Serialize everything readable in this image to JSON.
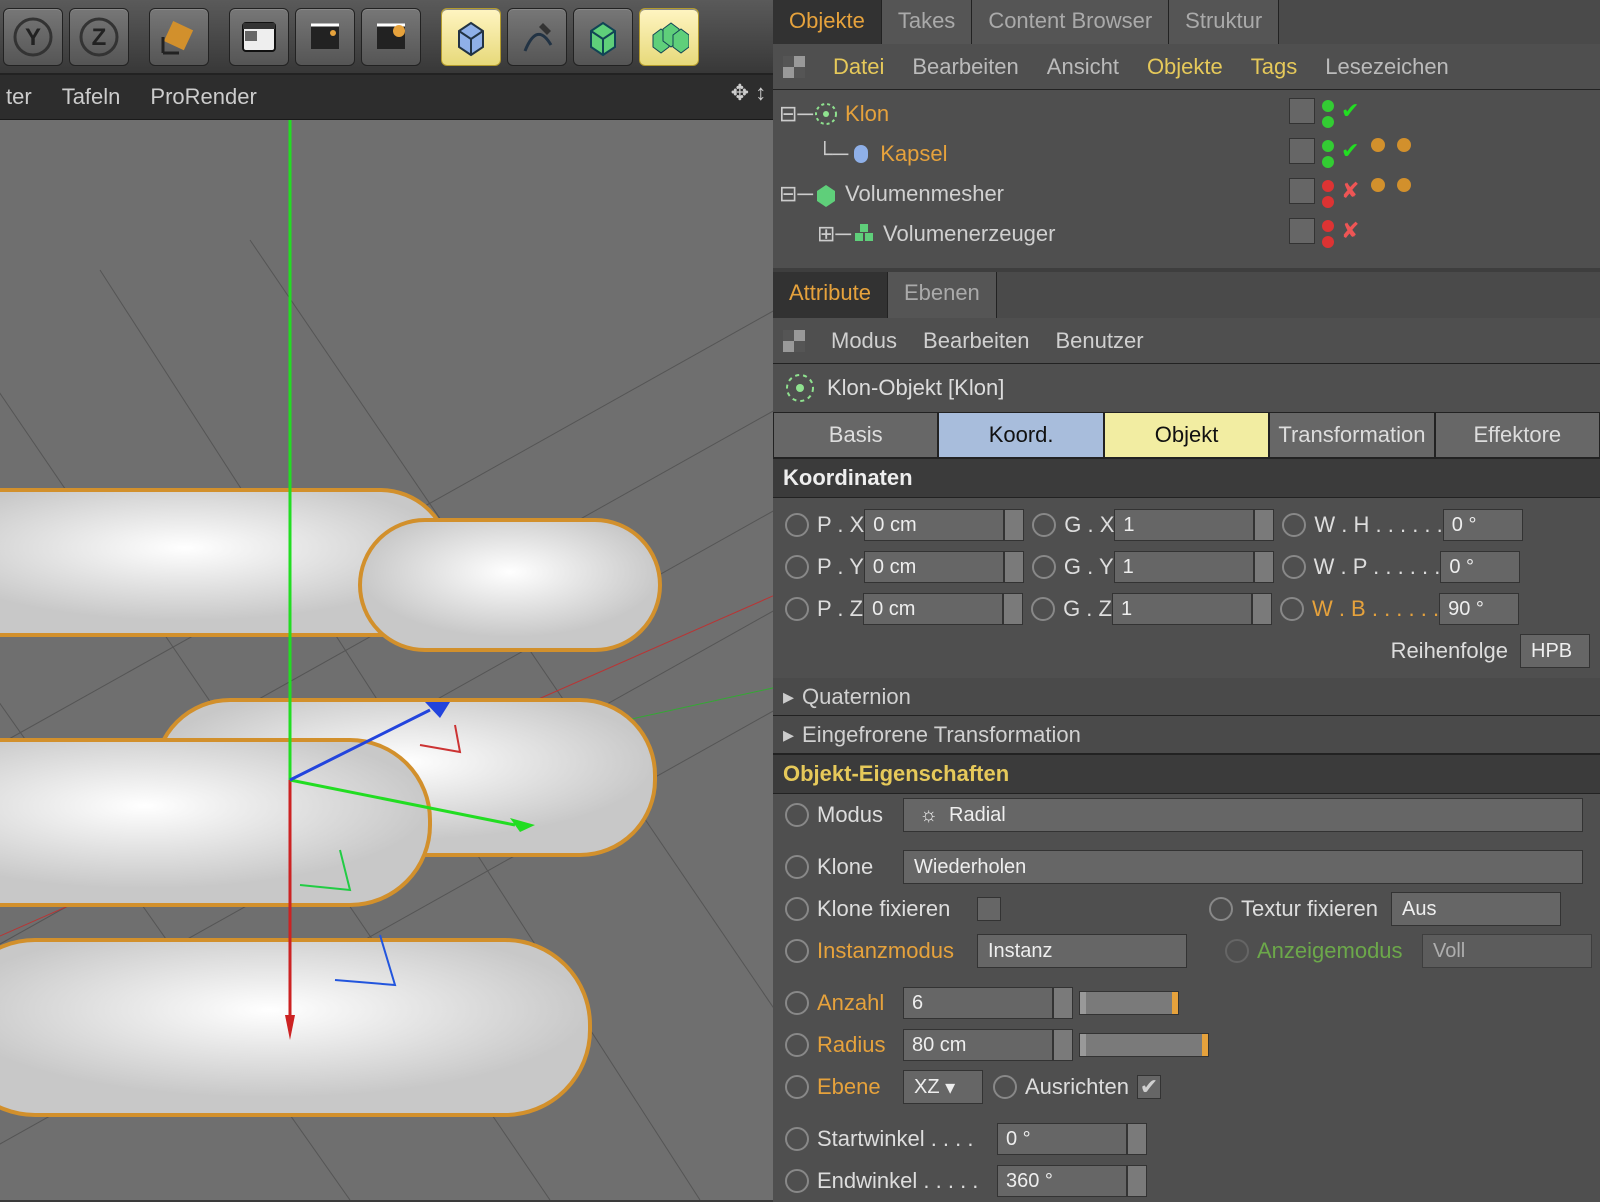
{
  "menubar": {
    "item1": "ter",
    "item2": "Tafeln",
    "item3": "ProRender"
  },
  "om": {
    "tabs": [
      "Objekte",
      "Takes",
      "Content Browser",
      "Struktur"
    ],
    "menu": [
      "Datei",
      "Bearbeiten",
      "Ansicht",
      "Objekte",
      "Tags",
      "Lesezeichen"
    ],
    "tree": [
      {
        "name": "Klon",
        "sel": true,
        "ok": true,
        "tags": 0
      },
      {
        "name": "Kapsel",
        "sel": true,
        "ok": true,
        "tags": 2,
        "indent": 1
      },
      {
        "name": "Volumenmesher",
        "sel": false,
        "ok": false,
        "tags": 2
      },
      {
        "name": "Volumenerzeuger",
        "sel": false,
        "ok": false,
        "tags": 0,
        "indent": 1
      }
    ]
  },
  "attr": {
    "tabs": [
      "Attribute",
      "Ebenen"
    ],
    "menu": [
      "Modus",
      "Bearbeiten",
      "Benutzer"
    ],
    "title": "Klon-Objekt [Klon]",
    "bar": [
      "Basis",
      "Koord.",
      "Objekt",
      "Transformation",
      "Effektore"
    ],
    "coord_head": "Koordinaten",
    "px": "P . X",
    "py": "P . Y",
    "pz": "P . Z",
    "gx": "G . X",
    "gy": "G . Y",
    "gz": "G . Z",
    "wh": "W . H . . . . . .",
    "wp": "W . P . . . . . .",
    "wb": "W . B . . . . . .",
    "px_v": "0 cm",
    "py_v": "0 cm",
    "pz_v": "0 cm",
    "gx_v": "1",
    "gy_v": "1",
    "gz_v": "1",
    "wh_v": "0 °",
    "wp_v": "0 °",
    "wb_v": "90 °",
    "reih": "Reihenfolge",
    "reih_v": "HPB",
    "quat": "Quaternion",
    "eing": "Eingefrorene Transformation",
    "obj_head": "Objekt-Eigenschaften",
    "modus": "Modus",
    "modus_v": "Radial",
    "klone": "Klone",
    "klone_v": "Wiederholen",
    "klone_fix": "Klone fixieren",
    "tex_fix": "Textur fixieren",
    "tex_fix_v": "Aus",
    "inst": "Instanzmodus",
    "inst_v": "Instanz",
    "anz_mod": "Anzeigemodus",
    "anz_mod_v": "Voll",
    "anzahl": "Anzahl",
    "anzahl_v": "6",
    "radius": "Radius",
    "radius_v": "80 cm",
    "ebene": "Ebene",
    "ebene_v": "XZ",
    "ausr": "Ausrichten",
    "startw": "Startwinkel . . . .",
    "startw_v": "0 °",
    "endw": "Endwinkel . . . . .",
    "endw_v": "360 °"
  }
}
